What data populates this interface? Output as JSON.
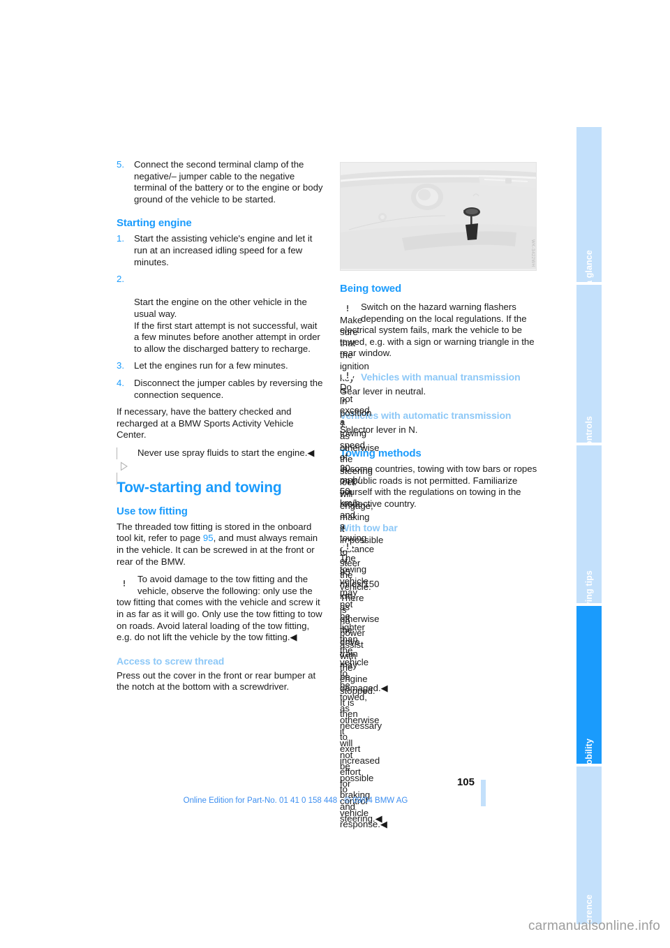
{
  "document": {
    "page_number": "105",
    "footer_note": "Online Edition for Part-No. 01 41 0 158 448 - © 09/04 BMW AG",
    "watermark": "carmanualsonline.info"
  },
  "tab_rail": {
    "tabs": [
      {
        "label": "At a glance",
        "active": false
      },
      {
        "label": "Controls",
        "active": false
      },
      {
        "label": "Driving tips",
        "active": false
      },
      {
        "label": "Mobility",
        "active": true
      },
      {
        "label": "Reference",
        "active": false
      }
    ]
  },
  "colors": {
    "heading_primary": "#1a9bfc",
    "heading_tertiary": "#8dc8f7",
    "tab_inactive": "#c3e0fb",
    "tab_active": "#1a9bfc",
    "footer_text": "#3c8ef0",
    "body_text": "#1a1a1a"
  },
  "left_column": {
    "step5": {
      "num": "5.",
      "text": "Connect the second terminal clamp of the negative/– jumper cable to the negative terminal of the battery or to the engine or body ground of the vehicle to be started."
    },
    "starting_engine": {
      "heading": "Starting engine",
      "steps": [
        {
          "num": "1.",
          "text": "Start the assisting vehicle's engine and let it run at an increased idling speed for a few minutes."
        },
        {
          "num": "2.",
          "text": "Start the engine on the other vehicle in the usual way.\nIf the first start attempt is not successful, wait a few minutes before another attempt in order to allow the discharged battery to recharge."
        },
        {
          "num": "3.",
          "text": "Let the engines run for a few minutes."
        },
        {
          "num": "4.",
          "text": "Disconnect the jumper cables by reversing the connection sequence."
        }
      ],
      "after_text": "If necessary, have the battery checked and recharged at a BMW Sports Activity Vehicle Center.",
      "note_icon": "note-triangle-icon",
      "note_text": "Never use spray fluids to start the engine.◀"
    },
    "tow_section": {
      "heading": "Tow-starting and towing",
      "use_tow_fitting": {
        "heading": "Use tow fitting",
        "text_before_ref": "The threaded tow fitting is stored in the onboard tool kit, refer to page ",
        "page_ref": "95",
        "text_after_ref": ", and must always remain in the vehicle. It can be screwed in at the front or rear of the BMW.",
        "warning_icon": "warning-triangle-icon",
        "warning_text": "To avoid damage to the tow fitting and the vehicle, observe the following: only use the tow fitting that comes with the vehicle and screw it in as far as it will go. Only use the tow fitting to tow on roads. Avoid lateral loading of the tow fitting, e.g. do not lift the vehicle by the tow fitting.◀"
      },
      "access_screw_thread": {
        "heading": "Access to screw thread",
        "text": "Press out the cover in the front or rear bumper at the notch at the bottom with a screwdriver."
      }
    }
  },
  "right_column": {
    "figure": {
      "name": "bumper-screwdriver-illustration",
      "code": "WK-3422WH"
    },
    "being_towed": {
      "heading": "Being towed",
      "warning_icon": "warning-triangle-icon",
      "warning_text": "Make sure that the ignition key is in position 1, as otherwise the steering lock will engage, making it impossible to steer the vehicle. There is no power assist with the engine stopped. It is then necessary to exert increased effort for braking and steering.◀",
      "body_text": "Switch on the hazard warning flashers depending on the local regulations. If the electrical system fails, mark the vehicle to be towed, e.g. with a sign or warning triangle in the rear window.",
      "warning2_icon": "warning-triangle-icon",
      "warning2_text": "Do not exceed a towing speed of 30 mph/ 50 km/h and a towing distance of 95 miles/150 km, as otherwise the drive train may be damaged.◀"
    },
    "manual_transmission": {
      "heading": "Vehicles with manual transmission",
      "text": "Gear lever in neutral."
    },
    "automatic_transmission": {
      "heading": "Vehicles with automatic transmission",
      "text": "Selector lever in N."
    },
    "towing_methods": {
      "heading": "Towing methods",
      "text": "In some countries, towing with tow bars or ropes on public roads is not permitted. Familiarize yourself with the regulations on towing in the respective country."
    },
    "with_tow_bar": {
      "heading": "With tow bar",
      "warning_icon": "warning-triangle-icon",
      "warning_text": "The towing vehicle may not be lighter than the vehicle to be towed, as otherwise it will not be possible to control vehicle response.◀"
    }
  }
}
